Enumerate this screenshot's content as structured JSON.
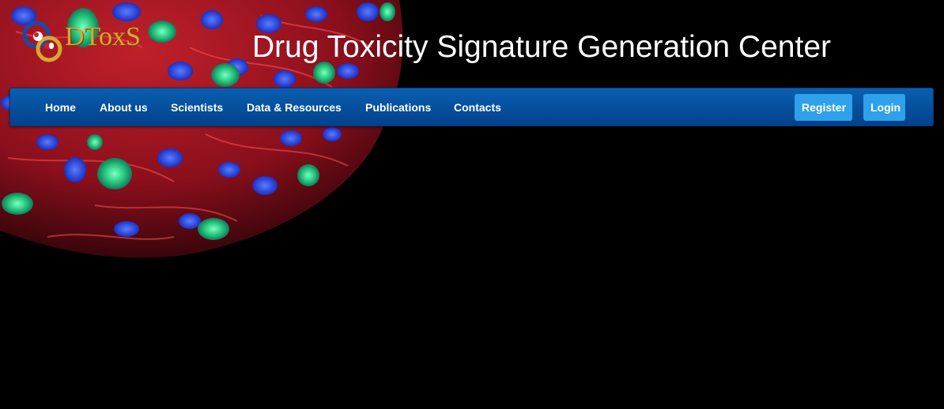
{
  "header": {
    "logo_text": "DToxS",
    "title": "Drug Toxicity Signature Generation Center"
  },
  "nav": {
    "items": [
      {
        "label": "Home"
      },
      {
        "label": "About us"
      },
      {
        "label": "Scientists"
      },
      {
        "label": "Data & Resources"
      },
      {
        "label": "Publications"
      },
      {
        "label": "Contacts"
      }
    ],
    "register_label": "Register",
    "login_label": "Login"
  },
  "colors": {
    "navbar": "#0a5fb0",
    "button": "#2ea1ea",
    "logo_text": "#d9a72e",
    "background": "#000000"
  },
  "hero_image": {
    "icon": "cell-microscopy-image"
  }
}
